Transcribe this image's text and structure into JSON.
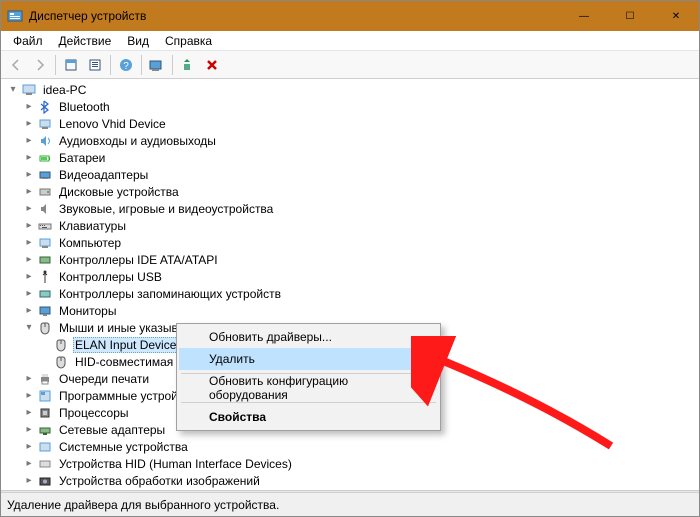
{
  "window": {
    "title": "Диспетчер устройств",
    "minimize": "—",
    "maximize": "☐",
    "close": "✕"
  },
  "menu": {
    "file": "Файл",
    "action": "Действие",
    "view": "Вид",
    "help": "Справка"
  },
  "tree": {
    "root": "idea-PC",
    "items": [
      "Bluetooth",
      "Lenovo Vhid Device",
      "Аудиовходы и аудиовыходы",
      "Батареи",
      "Видеоадаптеры",
      "Дисковые устройства",
      "Звуковые, игровые и видеоустройства",
      "Клавиатуры",
      "Компьютер",
      "Контроллеры IDE ATA/ATAPI",
      "Контроллеры USB",
      "Контроллеры запоминающих устройств",
      "Мониторы",
      "Мыши и иные указывающие устройства",
      "Очереди печати",
      "Программные устройства",
      "Процессоры",
      "Сетевые адаптеры",
      "Системные устройства",
      "Устройства HID (Human Interface Devices)",
      "Устройства обработки изображений"
    ],
    "mouse_children": [
      "ELAN Input Device",
      "HID-совместимая мышь"
    ]
  },
  "context": {
    "update": "Обновить драйверы...",
    "delete": "Удалить",
    "refresh": "Обновить конфигурацию оборудования",
    "properties": "Свойства"
  },
  "status": "Удаление драйвера для выбранного устройства."
}
